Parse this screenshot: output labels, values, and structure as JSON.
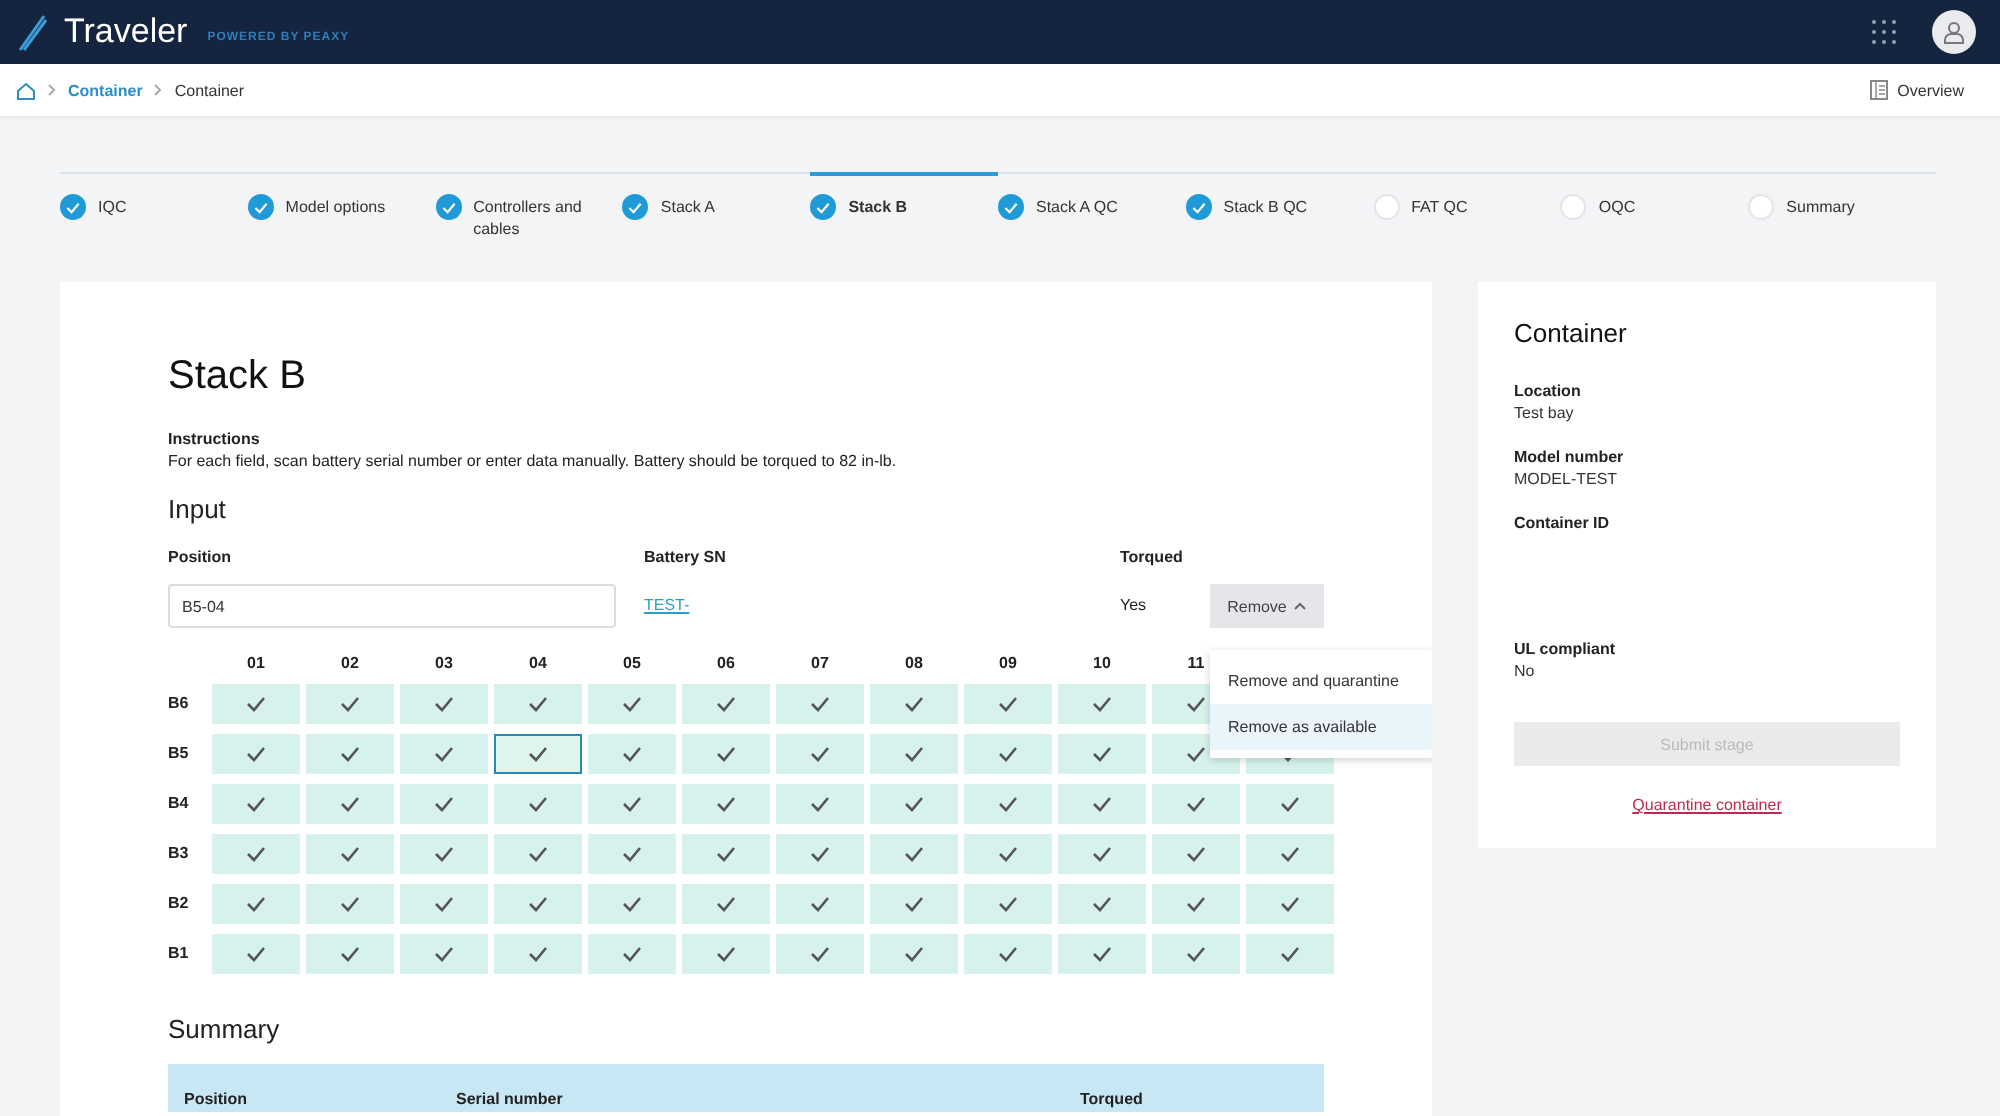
{
  "app": {
    "title": "Traveler",
    "tagline": "POWERED BY PEAXY"
  },
  "breadcrumb": {
    "items": [
      "Container",
      "Container"
    ],
    "overview": "Overview"
  },
  "steps": [
    {
      "label": "IQC",
      "done": true,
      "selected": false
    },
    {
      "label": "Model options",
      "done": true,
      "selected": false
    },
    {
      "label": "Controllers and cables",
      "done": true,
      "selected": false
    },
    {
      "label": "Stack A",
      "done": true,
      "selected": false
    },
    {
      "label": "Stack B",
      "done": true,
      "selected": true
    },
    {
      "label": "Stack A QC",
      "done": true,
      "selected": false
    },
    {
      "label": "Stack B QC",
      "done": true,
      "selected": false
    },
    {
      "label": "FAT QC",
      "done": false,
      "selected": false
    },
    {
      "label": "OQC",
      "done": false,
      "selected": false
    },
    {
      "label": "Summary",
      "done": false,
      "selected": false
    }
  ],
  "stage": {
    "title": "Stack B",
    "instructions_label": "Instructions",
    "instructions": "For each field, scan battery serial number or enter data manually. Battery should be torqued to 82 in-lb.",
    "input_heading": "Input",
    "position": {
      "label": "Position",
      "value": "B5-04"
    },
    "battery_sn": {
      "label": "Battery SN",
      "value": "TEST-"
    },
    "torqued": {
      "label": "Torqued",
      "value": "Yes"
    },
    "remove_button": {
      "label": "Remove",
      "expanded": true
    },
    "menu": [
      {
        "label": "Remove and quarantine",
        "highlighted": false
      },
      {
        "label": "Remove as available",
        "highlighted": true
      }
    ],
    "grid": {
      "columns": [
        "01",
        "02",
        "03",
        "04",
        "05",
        "06",
        "07",
        "08",
        "09",
        "10",
        "11"
      ],
      "rows": [
        {
          "label": "B6",
          "cells": [
            {
              "checked": true,
              "selected": false
            },
            {
              "checked": true,
              "selected": false
            },
            {
              "checked": true,
              "selected": false
            },
            {
              "checked": true,
              "selected": false
            },
            {
              "checked": true,
              "selected": false
            },
            {
              "checked": true,
              "selected": false
            },
            {
              "checked": true,
              "selected": false
            },
            {
              "checked": true,
              "selected": false
            },
            {
              "checked": true,
              "selected": false
            },
            {
              "checked": true,
              "selected": false
            },
            {
              "checked": true,
              "selected": false
            }
          ]
        },
        {
          "label": "B5",
          "cells": [
            {
              "checked": true,
              "selected": false
            },
            {
              "checked": true,
              "selected": false
            },
            {
              "checked": true,
              "selected": false
            },
            {
              "checked": true,
              "selected": true
            },
            {
              "checked": true,
              "selected": false
            },
            {
              "checked": true,
              "selected": false
            },
            {
              "checked": true,
              "selected": false
            },
            {
              "checked": true,
              "selected": false
            },
            {
              "checked": true,
              "selected": false
            },
            {
              "checked": true,
              "selected": false
            },
            {
              "checked": true,
              "selected": false
            },
            {
              "checked": true,
              "selected": false
            }
          ]
        },
        {
          "label": "B4",
          "cells": [
            {
              "checked": true,
              "selected": false
            },
            {
              "checked": true,
              "selected": false
            },
            {
              "checked": true,
              "selected": false
            },
            {
              "checked": true,
              "selected": false
            },
            {
              "checked": true,
              "selected": false
            },
            {
              "checked": true,
              "selected": false
            },
            {
              "checked": true,
              "selected": false
            },
            {
              "checked": true,
              "selected": false
            },
            {
              "checked": true,
              "selected": false
            },
            {
              "checked": true,
              "selected": false
            },
            {
              "checked": true,
              "selected": false
            },
            {
              "checked": true,
              "selected": false
            }
          ]
        },
        {
          "label": "B3",
          "cells": [
            {
              "checked": true,
              "selected": false
            },
            {
              "checked": true,
              "selected": false
            },
            {
              "checked": true,
              "selected": false
            },
            {
              "checked": true,
              "selected": false
            },
            {
              "checked": true,
              "selected": false
            },
            {
              "checked": true,
              "selected": false
            },
            {
              "checked": true,
              "selected": false
            },
            {
              "checked": true,
              "selected": false
            },
            {
              "checked": true,
              "selected": false
            },
            {
              "checked": true,
              "selected": false
            },
            {
              "checked": true,
              "selected": false
            },
            {
              "checked": true,
              "selected": false
            }
          ]
        },
        {
          "label": "B2",
          "cells": [
            {
              "checked": true,
              "selected": false
            },
            {
              "checked": true,
              "selected": false
            },
            {
              "checked": true,
              "selected": false
            },
            {
              "checked": true,
              "selected": false
            },
            {
              "checked": true,
              "selected": false
            },
            {
              "checked": true,
              "selected": false
            },
            {
              "checked": true,
              "selected": false
            },
            {
              "checked": true,
              "selected": false
            },
            {
              "checked": true,
              "selected": false
            },
            {
              "checked": true,
              "selected": false
            },
            {
              "checked": true,
              "selected": false
            },
            {
              "checked": true,
              "selected": false
            }
          ]
        },
        {
          "label": "B1",
          "cells": [
            {
              "checked": true,
              "selected": false
            },
            {
              "checked": true,
              "selected": false
            },
            {
              "checked": true,
              "selected": false
            },
            {
              "checked": true,
              "selected": false
            },
            {
              "checked": true,
              "selected": false
            },
            {
              "checked": true,
              "selected": false
            },
            {
              "checked": true,
              "selected": false
            },
            {
              "checked": true,
              "selected": false
            },
            {
              "checked": true,
              "selected": false
            },
            {
              "checked": true,
              "selected": false
            },
            {
              "checked": true,
              "selected": false
            },
            {
              "checked": true,
              "selected": false
            }
          ]
        }
      ]
    },
    "summary_heading": "Summary",
    "summary_columns": [
      "Position",
      "Serial number",
      "Torqued"
    ]
  },
  "container": {
    "title": "Container",
    "fields": [
      {
        "label": "Location",
        "value": "Test bay"
      },
      {
        "label": "Model number",
        "value": "MODEL-TEST"
      },
      {
        "label": "Container ID"
      },
      {
        "label": "UL compliant",
        "value": "No"
      }
    ],
    "submit": {
      "label": "Submit stage",
      "disabled": true
    },
    "quarantine_link": "Quarantine container"
  }
}
